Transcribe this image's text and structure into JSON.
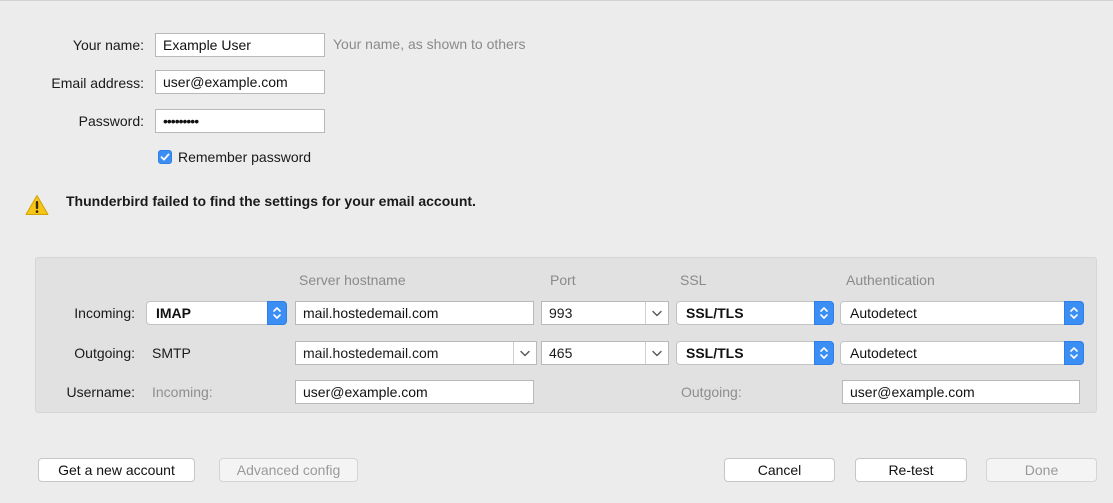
{
  "account": {
    "name_label": "Your name:",
    "name_value": "Example User",
    "name_hint": "Your name, as shown to others",
    "email_label": "Email address:",
    "email_value": "user@example.com",
    "password_label": "Password:",
    "password_value": "•••••••••",
    "remember_label": "Remember password",
    "remember_checked": true
  },
  "warning": {
    "icon": "warning-triangle-icon",
    "message": "Thunderbird failed to find the settings for your email account."
  },
  "server": {
    "headers": {
      "hostname": "Server hostname",
      "port": "Port",
      "ssl": "SSL",
      "auth": "Authentication"
    },
    "incoming": {
      "label": "Incoming:",
      "protocol": "IMAP",
      "hostname": "mail.hostedemail.com",
      "port": "993",
      "ssl": "SSL/TLS",
      "auth": "Autodetect"
    },
    "outgoing": {
      "label": "Outgoing:",
      "protocol": "SMTP",
      "hostname": "mail.hostedemail.com",
      "port": "465",
      "ssl": "SSL/TLS",
      "auth": "Autodetect"
    },
    "username": {
      "label": "Username:",
      "incoming_label": "Incoming:",
      "incoming_value": "user@example.com",
      "outgoing_label": "Outgoing:",
      "outgoing_value": "user@example.com"
    }
  },
  "buttons": {
    "new_account": "Get a new account",
    "advanced": "Advanced config",
    "cancel": "Cancel",
    "retest": "Re-test",
    "done": "Done"
  },
  "colors": {
    "accent": "#3b8ff4",
    "warning": "#f5c518",
    "background": "#ececec"
  }
}
